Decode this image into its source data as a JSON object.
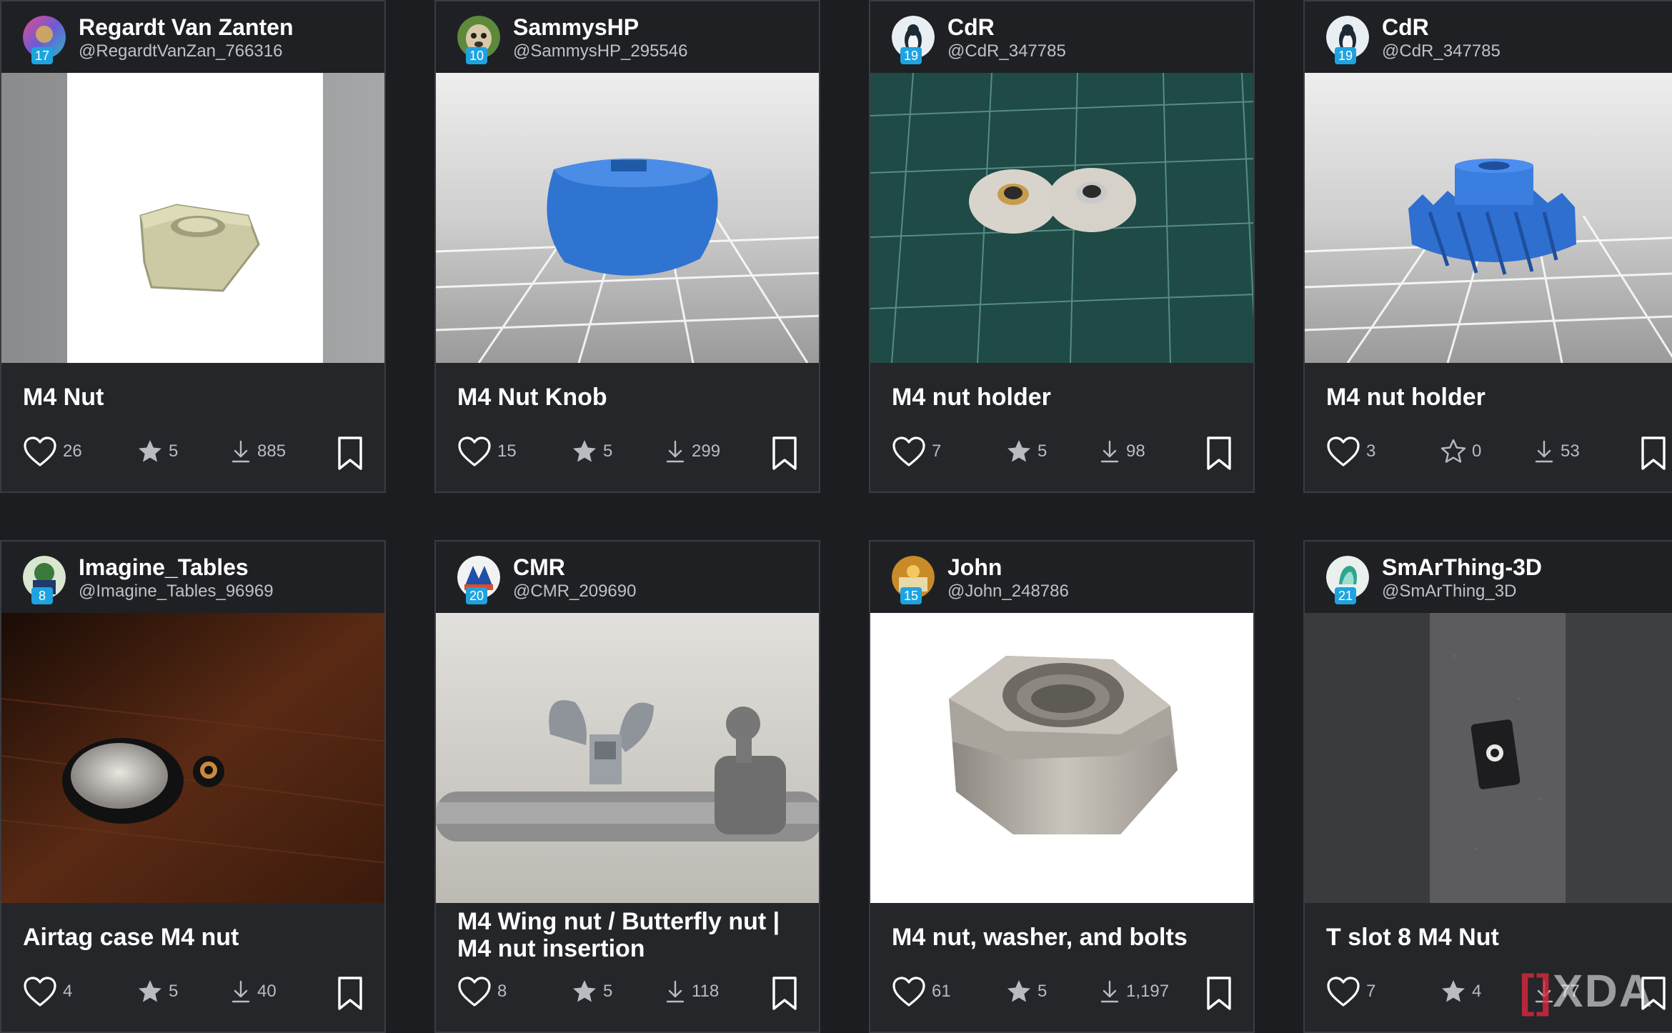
{
  "cards": [
    {
      "user_name": "Regardt Van Zanten",
      "user_handle": "@RegardtVanZan_766316",
      "level": "17",
      "title": "M4 Nut",
      "likes": "26",
      "rating": "5",
      "downloads": "885"
    },
    {
      "user_name": "SammysHP",
      "user_handle": "@SammysHP_295546",
      "level": "10",
      "title": "M4 Nut Knob",
      "likes": "15",
      "rating": "5",
      "downloads": "299"
    },
    {
      "user_name": "CdR",
      "user_handle": "@CdR_347785",
      "level": "19",
      "title": "M4 nut holder",
      "likes": "7",
      "rating": "5",
      "downloads": "98"
    },
    {
      "user_name": "CdR",
      "user_handle": "@CdR_347785",
      "level": "19",
      "title": "M4 nut holder",
      "likes": "3",
      "rating": "0",
      "downloads": "53"
    },
    {
      "user_name": "Imagine_Tables",
      "user_handle": "@Imagine_Tables_96969",
      "level": "8",
      "title": "Airtag case M4 nut",
      "likes": "4",
      "rating": "5",
      "downloads": "40"
    },
    {
      "user_name": "CMR",
      "user_handle": "@CMR_209690",
      "level": "20",
      "title": "M4 Wing nut / Butterfly nut | M4 nut insertion",
      "likes": "8",
      "rating": "5",
      "downloads": "118"
    },
    {
      "user_name": "John",
      "user_handle": "@John_248786",
      "level": "15",
      "title": "M4 nut, washer, and bolts",
      "likes": "61",
      "rating": "5",
      "downloads": "1,197"
    },
    {
      "user_name": "SmArThing-3D",
      "user_handle": "@SmArThing_3D",
      "level": "21",
      "title": "T slot 8 M4 Nut",
      "likes": "7",
      "rating": "4",
      "downloads": "77"
    }
  ],
  "icons": {
    "like": "heart-icon",
    "rating": "star-icon",
    "download": "download-icon",
    "save": "bookmark-icon"
  },
  "colors": {
    "background": "#1c1d21",
    "card": "#24262a",
    "level_badge": "#1fa3e0",
    "stat_text": "#b8bbc0"
  },
  "watermark": {
    "bracket_left": "[",
    "bracket_right": "]",
    "text": "XDA"
  }
}
